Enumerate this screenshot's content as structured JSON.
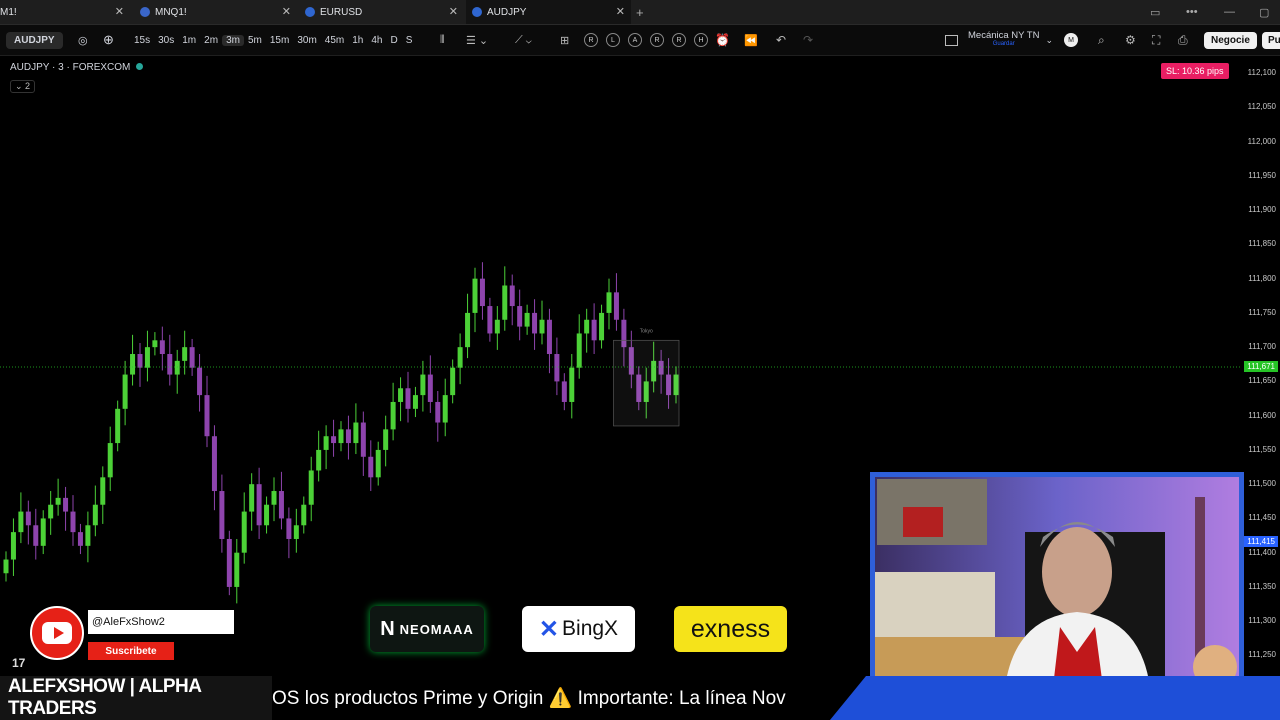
{
  "tabs": [
    {
      "label": "M1!",
      "active": false
    },
    {
      "label": "MNQ1!",
      "active": false
    },
    {
      "label": "EURUSD",
      "active": false
    },
    {
      "label": "AUDJPY",
      "active": true
    }
  ],
  "toolbar": {
    "symbol": "AUDJPY",
    "timeframes": [
      "15s",
      "30s",
      "1m",
      "2m",
      "3m",
      "5m",
      "15m",
      "30m",
      "45m",
      "1h",
      "4h",
      "D",
      "S"
    ],
    "selected_timeframe": "3m",
    "replay_letters": [
      "R",
      "L",
      "A",
      "R",
      "R",
      "H"
    ],
    "layout_name": "Mecánica NY TN",
    "layout_sub": "Guardar",
    "trade_label": "Negocie",
    "extra_label": "Pu"
  },
  "chart": {
    "symbol_line": "AUDJPY · 3 · FOREXCOM",
    "collapse_label": "⌄ 2",
    "sl_badge": "SL: 10.36 pips",
    "box_label": "Tokyo",
    "price_axis": [
      "112,100",
      "112,050",
      "112,000",
      "111,950",
      "111,900",
      "111,850",
      "111,800",
      "111,750",
      "111,700",
      "111,650",
      "111,600",
      "111,550",
      "111,500",
      "111,450",
      "111,400",
      "111,350",
      "111,300",
      "111,250"
    ],
    "current_price": "111,671",
    "current_price_color": "#26c326",
    "secondary_price": "111,415",
    "secondary_price_color": "#2962ff"
  },
  "chart_data": {
    "type": "candlestick",
    "title": "AUDJPY · 3 · FOREXCOM",
    "ylim": [
      111.22,
      112.125
    ],
    "up_color": "#4cd137",
    "down_color": "#8e44ad",
    "closes": [
      111.39,
      111.43,
      111.46,
      111.44,
      111.41,
      111.45,
      111.47,
      111.48,
      111.46,
      111.43,
      111.41,
      111.44,
      111.47,
      111.51,
      111.56,
      111.61,
      111.66,
      111.69,
      111.67,
      111.7,
      111.71,
      111.69,
      111.66,
      111.68,
      111.7,
      111.67,
      111.63,
      111.57,
      111.49,
      111.42,
      111.35,
      111.4,
      111.46,
      111.5,
      111.44,
      111.47,
      111.49,
      111.45,
      111.42,
      111.44,
      111.47,
      111.52,
      111.55,
      111.57,
      111.56,
      111.58,
      111.56,
      111.59,
      111.54,
      111.51,
      111.55,
      111.58,
      111.62,
      111.64,
      111.61,
      111.63,
      111.66,
      111.62,
      111.59,
      111.63,
      111.67,
      111.7,
      111.75,
      111.8,
      111.76,
      111.72,
      111.74,
      111.79,
      111.76,
      111.73,
      111.75,
      111.72,
      111.74,
      111.69,
      111.65,
      111.62,
      111.67,
      111.72,
      111.74,
      111.71,
      111.75,
      111.78,
      111.74,
      111.7,
      111.66,
      111.62,
      111.65,
      111.68,
      111.66,
      111.63,
      111.66
    ]
  },
  "overlays": {
    "yt_handle": "@AleFxShow2",
    "yt_subscribe": "Suscribete",
    "sponsors": [
      "NEOMAAA",
      "BingX",
      "exness"
    ]
  },
  "banner": {
    "brand": "ALEFXSHOW | ALPHA TRADERS",
    "ticker": "OS los productos Prime y Origin  ⚠️ Importante: La línea Nov"
  }
}
